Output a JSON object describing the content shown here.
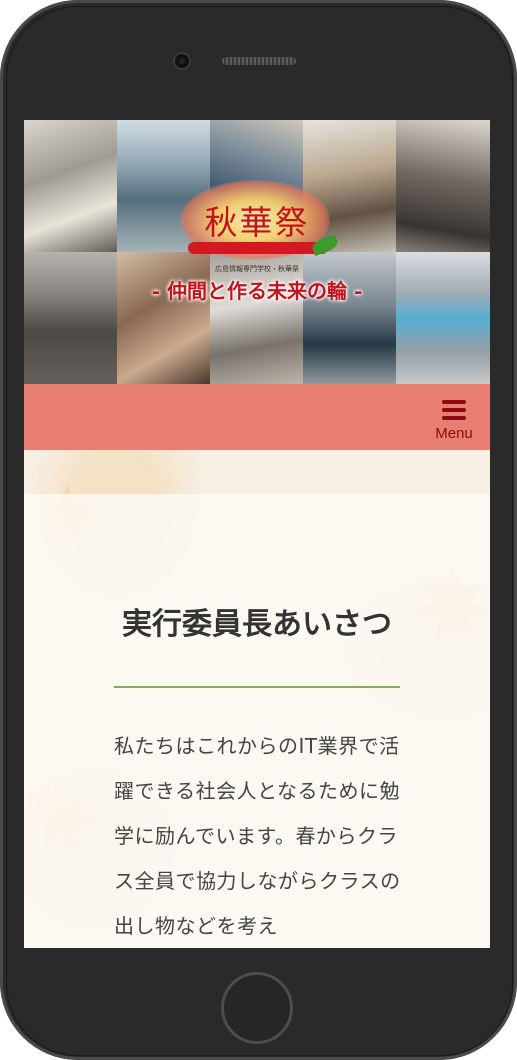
{
  "hero": {
    "logo_title": "秋華祭",
    "school_line": "広島情報専門学校・秋華祭",
    "slogan": "- 仲間と作る未来の輪 -"
  },
  "navbar": {
    "menu_label": "Menu",
    "color": "#e97f72"
  },
  "article": {
    "heading": "実行委員長あいさつ",
    "body": "私たちはこれからのIT業界で活躍できる社会人となるために勉学に励んでいます。春からクラス全員で協力しながらクラスの出し物などを考え"
  },
  "colors": {
    "accent": "#c4121c",
    "rule": "#7fb24a",
    "menu_icon": "#8a0b12"
  }
}
